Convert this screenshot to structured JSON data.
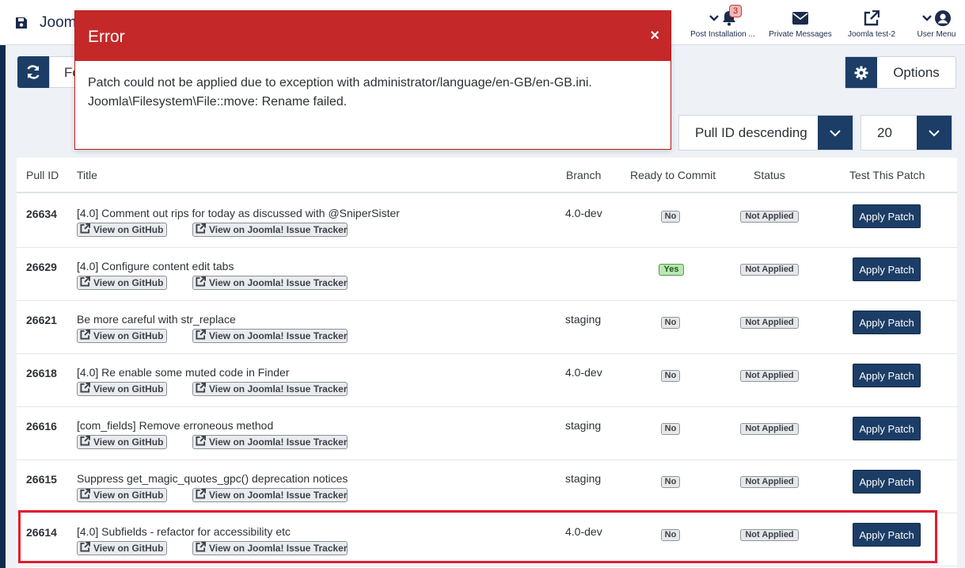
{
  "header": {
    "title": "Joomla!",
    "items": [
      {
        "label": "Post Installation ...",
        "icon": "bell-icon",
        "badge": "3"
      },
      {
        "label": "Private Messages",
        "icon": "envelope-icon"
      },
      {
        "label": "Joomla test-2",
        "icon": "external-link-icon"
      },
      {
        "label": "User Menu",
        "icon": "user-circle-icon"
      }
    ]
  },
  "toolbar": {
    "filter_value": "Fe",
    "options_label": "Options",
    "sort_value": "Pull ID descending",
    "limit_value": "20"
  },
  "modal": {
    "title": "Error",
    "close": "×",
    "message_line1": "Patch could not be applied due to exception with administrator/language/en-GB/en-GB.ini.",
    "message_line2": "Joomla\\Filesystem\\File::move: Rename failed."
  },
  "table": {
    "headers": {
      "pull_id": "Pull ID",
      "title": "Title",
      "branch": "Branch",
      "ready": "Ready to Commit",
      "status": "Status",
      "test": "Test This Patch"
    },
    "github_label": "View on GitHub",
    "tracker_label": "View on Joomla! Issue Tracker",
    "apply_label": "Apply Patch",
    "rows": [
      {
        "id": "26634",
        "title": "[4.0] Comment out rips for today as discussed with @SniperSister",
        "branch": "4.0-dev",
        "ready": "No",
        "status": "Not Applied"
      },
      {
        "id": "26629",
        "title": "[4.0] Configure content edit tabs",
        "branch": "",
        "ready": "Yes",
        "status": "Not Applied"
      },
      {
        "id": "26621",
        "title": "Be more careful with str_replace",
        "branch": "staging",
        "ready": "No",
        "status": "Not Applied"
      },
      {
        "id": "26618",
        "title": "[4.0] Re enable some muted code in Finder",
        "branch": "4.0-dev",
        "ready": "No",
        "status": "Not Applied"
      },
      {
        "id": "26616",
        "title": "[com_fields] Remove erroneous method",
        "branch": "staging",
        "ready": "No",
        "status": "Not Applied"
      },
      {
        "id": "26615",
        "title": "Suppress get_magic_quotes_gpc() deprecation notices",
        "branch": "staging",
        "ready": "No",
        "status": "Not Applied"
      },
      {
        "id": "26614",
        "title": "[4.0] Subfields - refactor for accessibility etc",
        "branch": "4.0-dev",
        "ready": "No",
        "status": "Not Applied"
      }
    ]
  },
  "colors": {
    "primary": "#1c3d66",
    "error": "#c52828",
    "highlight": "#e21c2e",
    "yes_green": "#b9e8b4"
  }
}
